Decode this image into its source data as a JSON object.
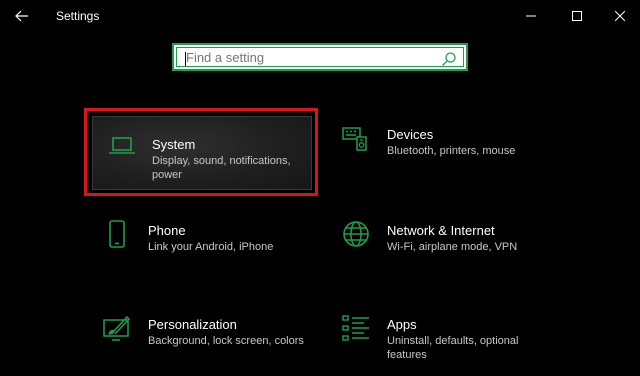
{
  "window": {
    "title": "Settings"
  },
  "search": {
    "placeholder": "Find a setting",
    "value": ""
  },
  "colors": {
    "accent": "#1f9e4a",
    "highlight_border": "#d9141b",
    "background": "#000000"
  },
  "tiles": [
    {
      "title": "System",
      "description": "Display, sound, notifications, power",
      "icon": "laptop-icon",
      "highlighted": true
    },
    {
      "title": "Devices",
      "description": "Bluetooth, printers, mouse",
      "icon": "devices-icon"
    },
    {
      "title": "Phone",
      "description": "Link your Android, iPhone",
      "icon": "phone-icon"
    },
    {
      "title": "Network & Internet",
      "description": "Wi-Fi, airplane mode, VPN",
      "icon": "globe-icon"
    },
    {
      "title": "Personalization",
      "description": "Background, lock screen, colors",
      "icon": "paintbrush-icon"
    },
    {
      "title": "Apps",
      "description": "Uninstall, defaults, optional features",
      "icon": "apps-list-icon"
    }
  ]
}
